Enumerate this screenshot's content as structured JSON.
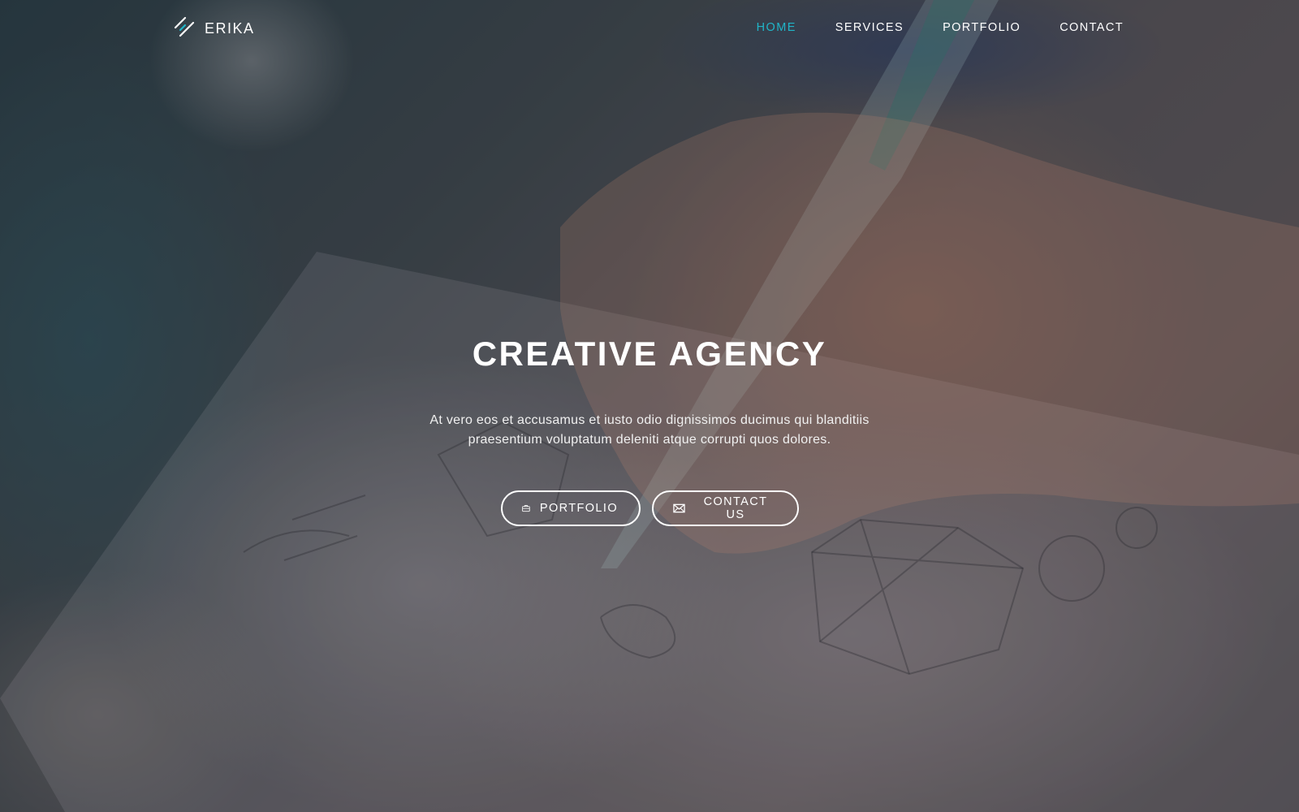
{
  "brand": {
    "name": "ERIKA",
    "logo_icon": "slash-lines-logo",
    "accent_color": "#20b5c8"
  },
  "nav": {
    "items": [
      {
        "label": "HOME",
        "active": true
      },
      {
        "label": "SERVICES",
        "active": false
      },
      {
        "label": "PORTFOLIO",
        "active": false
      },
      {
        "label": "CONTACT",
        "active": false
      }
    ]
  },
  "hero": {
    "title": "CREATIVE AGENCY",
    "subtitle_line1": "At vero eos et accusamus et iusto odio dignissimos ducimus qui blanditiis",
    "subtitle_line2": "praesentium voluptatum deleniti atque corrupti quos dolores.",
    "buttons": {
      "portfolio": {
        "label": "PORTFOLIO",
        "icon": "briefcase-icon"
      },
      "contact": {
        "label": "CONTACT US",
        "icon": "envelope-icon"
      }
    }
  }
}
